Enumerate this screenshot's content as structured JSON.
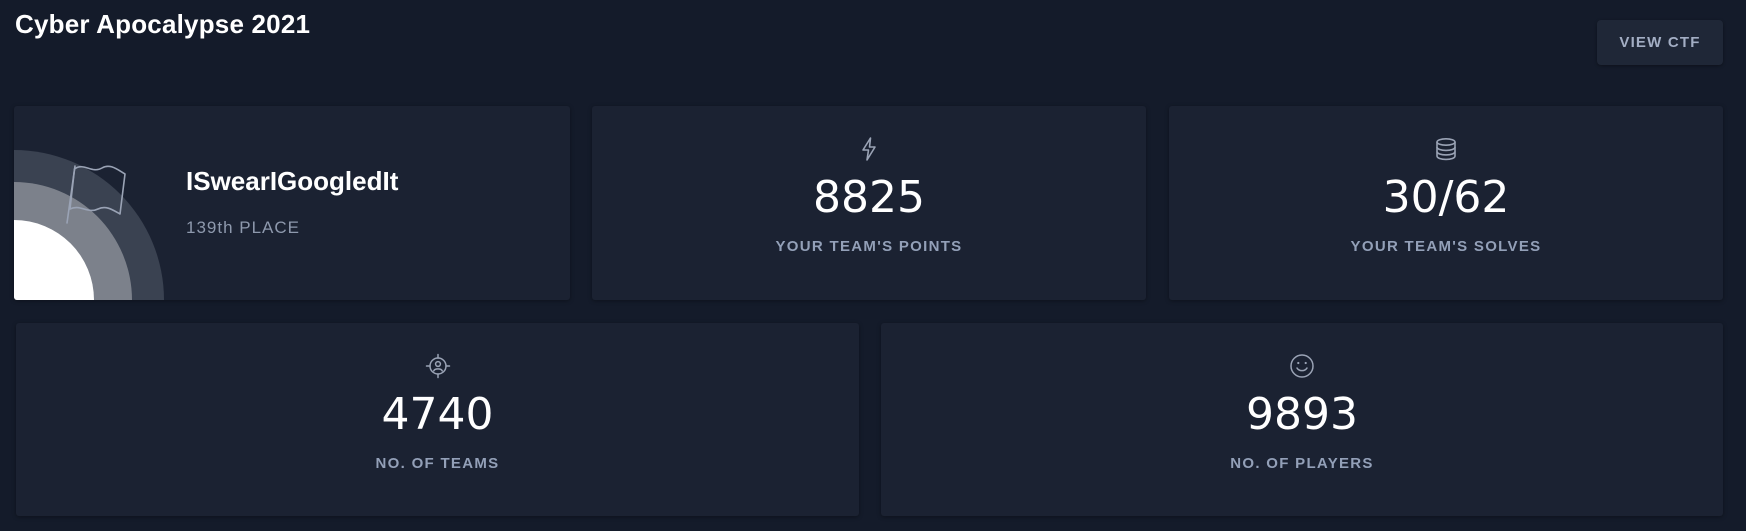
{
  "header": {
    "title": "Cyber Apocalypse 2021",
    "view_ctf_label": "VIEW CTF"
  },
  "team_card": {
    "team_name": "ISwearIGoogledIt",
    "place": "139th PLACE",
    "icon": "flag-icon"
  },
  "stats": {
    "points": {
      "value": "8825",
      "label": "YOUR TEAM'S POINTS",
      "icon": "lightning-icon"
    },
    "solves": {
      "value": "30/62",
      "label": "YOUR TEAM'S SOLVES",
      "icon": "database-icon"
    },
    "teams": {
      "value": "4740",
      "label": "NO. OF TEAMS",
      "icon": "target-icon"
    },
    "players": {
      "value": "9893",
      "label": "NO. OF PLAYERS",
      "icon": "smiley-icon"
    }
  },
  "colors": {
    "background": "#141b2a",
    "card": "#1b2232",
    "label": "#93a0b8"
  }
}
